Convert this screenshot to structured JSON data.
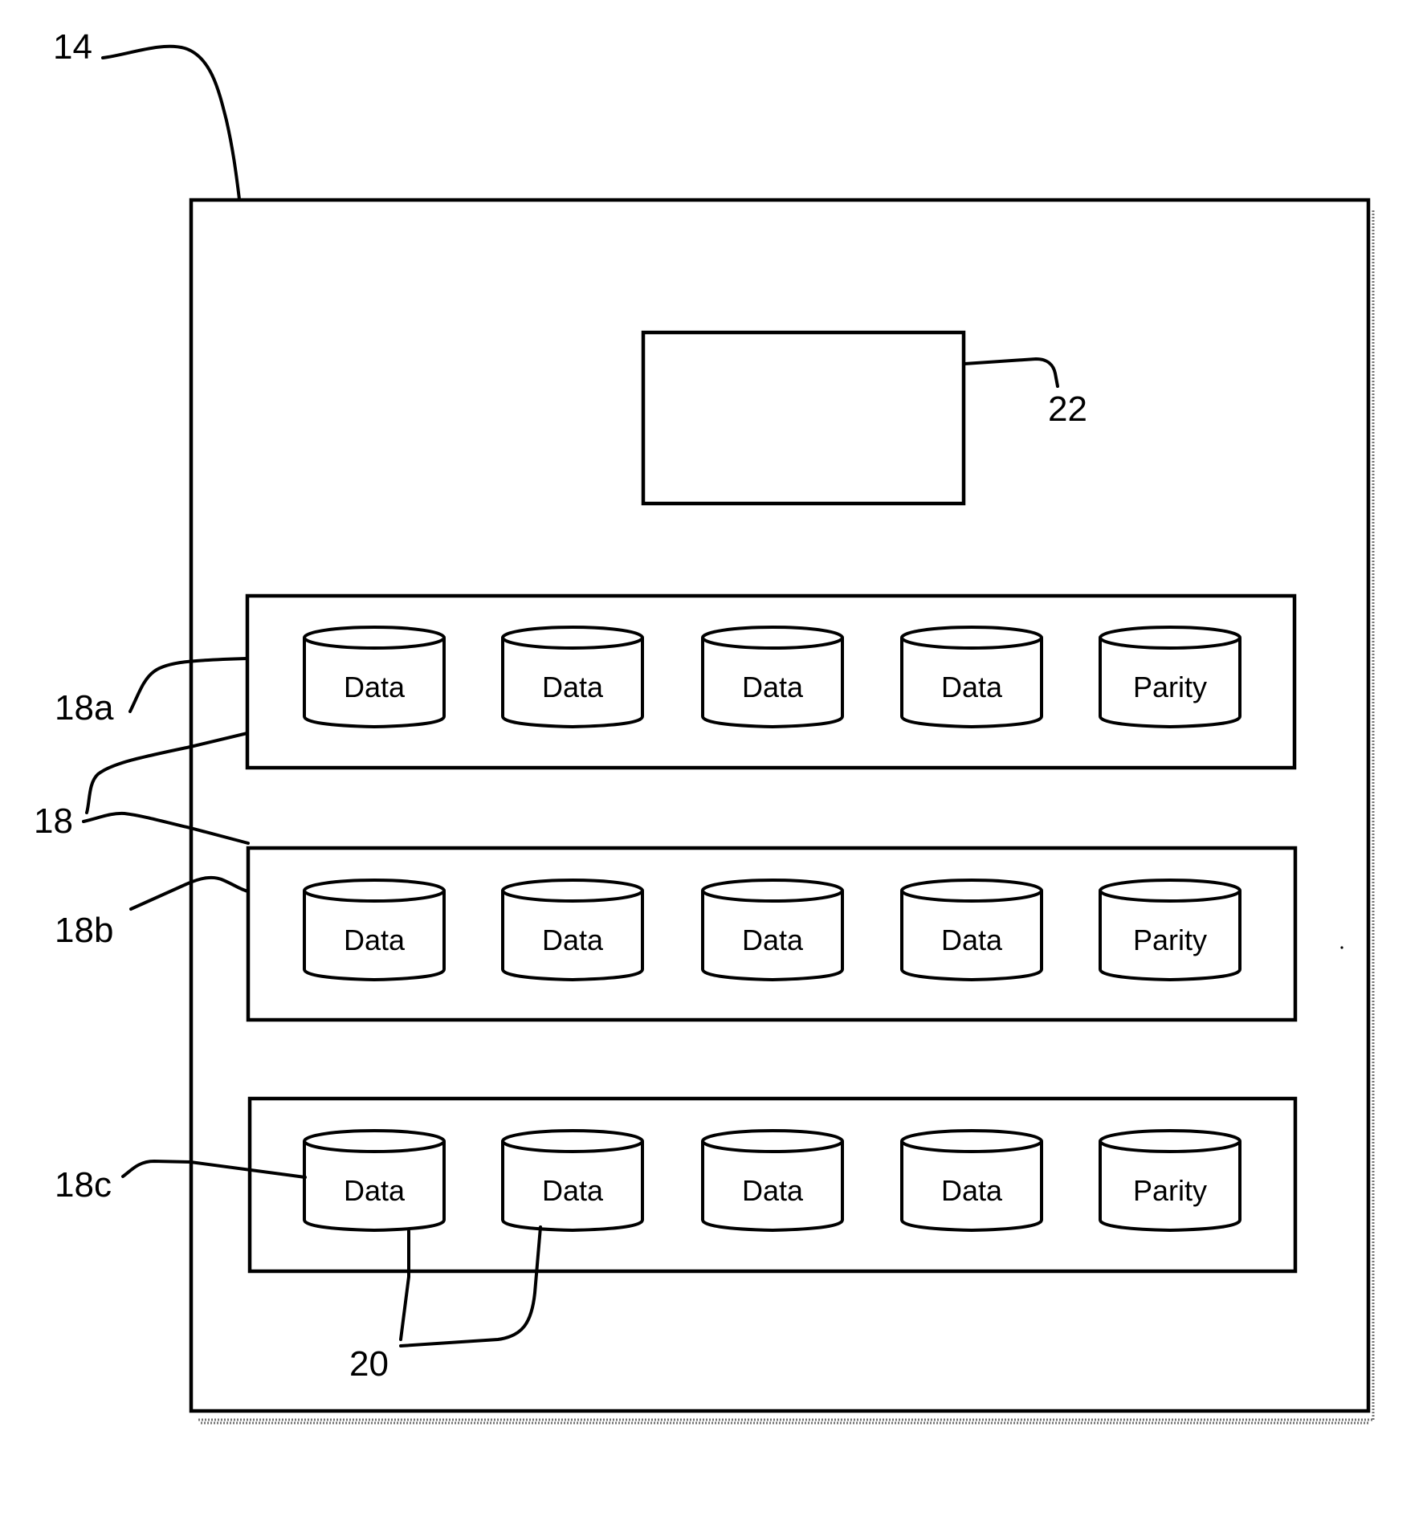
{
  "figure": {
    "type": "patent-style block diagram",
    "subject": "storage array with RAID groups of data and parity disks"
  },
  "reference_labels": {
    "enclosure": "14",
    "controller": "22",
    "group_a": "18a",
    "groups": "18",
    "group_b": "18b",
    "group_c": "18c",
    "disks": "20"
  },
  "controller": {
    "ref": "22",
    "label": ""
  },
  "groups": [
    {
      "ref": "18a",
      "disks": [
        {
          "label": "Data",
          "role": "data"
        },
        {
          "label": "Data",
          "role": "data"
        },
        {
          "label": "Data",
          "role": "data"
        },
        {
          "label": "Data",
          "role": "data"
        },
        {
          "label": "Parity",
          "role": "parity"
        }
      ]
    },
    {
      "ref": "18b",
      "disks": [
        {
          "label": "Data",
          "role": "data"
        },
        {
          "label": "Data",
          "role": "data"
        },
        {
          "label": "Data",
          "role": "data"
        },
        {
          "label": "Data",
          "role": "data"
        },
        {
          "label": "Parity",
          "role": "parity"
        }
      ]
    },
    {
      "ref": "18c",
      "disks": [
        {
          "label": "Data",
          "role": "data"
        },
        {
          "label": "Data",
          "role": "data"
        },
        {
          "label": "Data",
          "role": "data"
        },
        {
          "label": "Data",
          "role": "data"
        },
        {
          "label": "Parity",
          "role": "parity"
        }
      ]
    }
  ],
  "colors": {
    "line": "#000000",
    "background": "#ffffff"
  }
}
